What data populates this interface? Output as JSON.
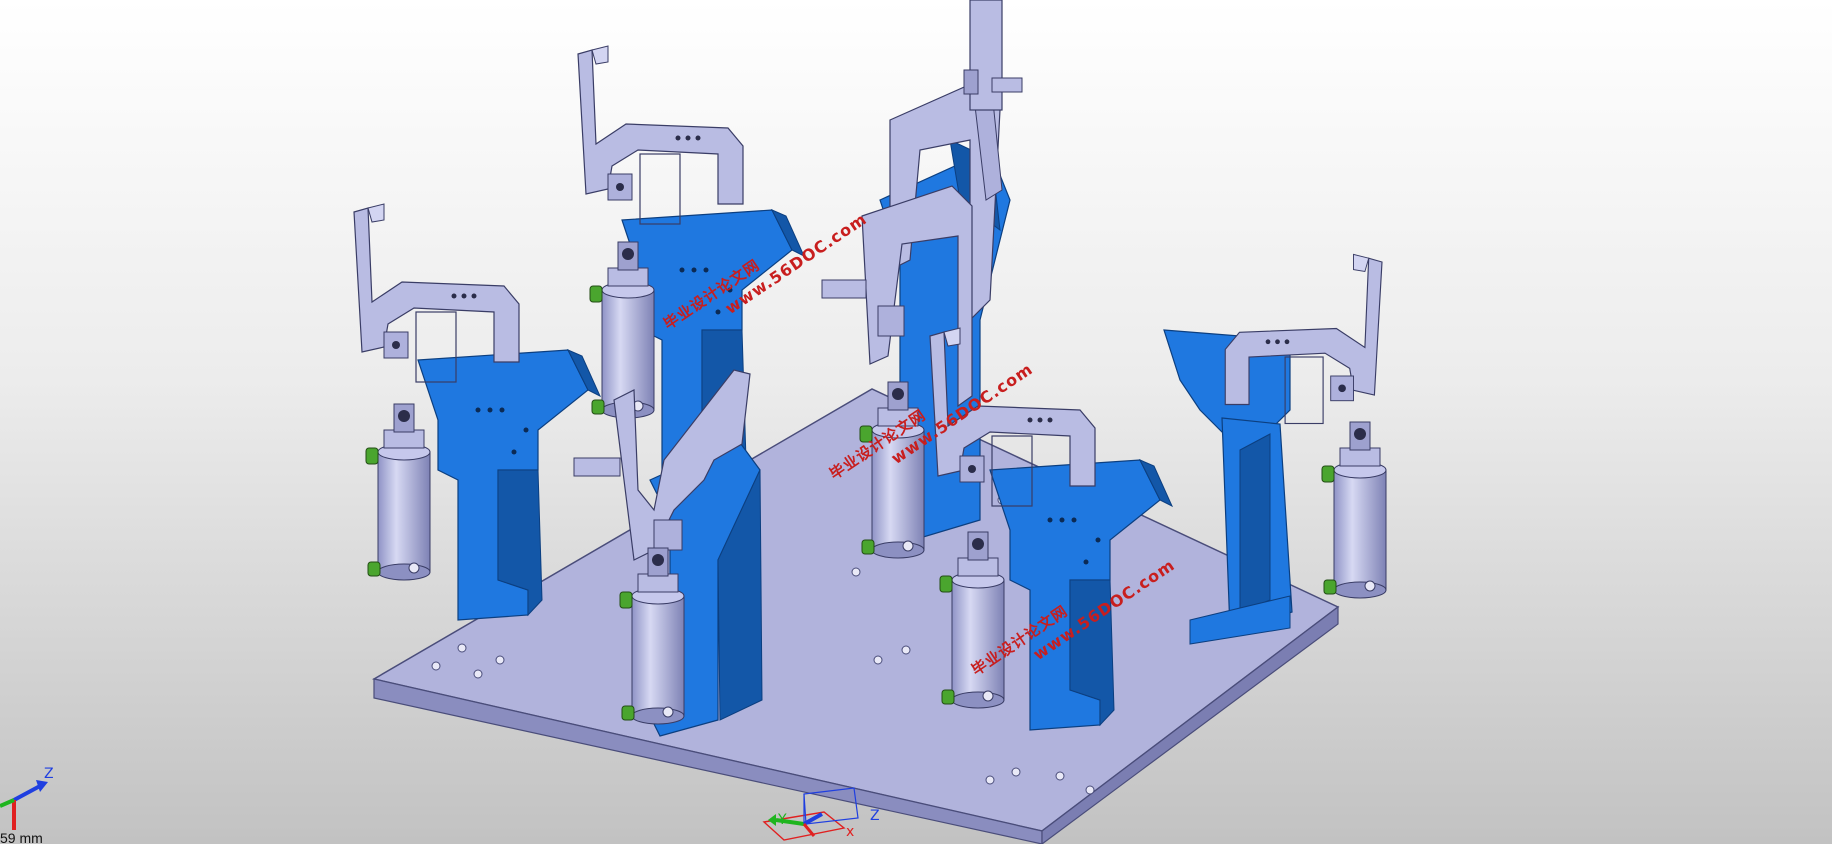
{
  "app": {
    "type": "CAD 3D viewport"
  },
  "colors": {
    "background_top": "#ffffff",
    "background_bottom": "#c2c2c2",
    "base_plate": "#a9abd6",
    "fixture_blue": "#1f78e0",
    "clamp_lavender": "#b9bce3",
    "fitting_green": "#4aa52e",
    "watermark_red": "#c81e1e",
    "axis_x": "#e02020",
    "axis_y": "#1fb51f",
    "axis_z": "#1f3fe0"
  },
  "watermarks": [
    {
      "line1": "毕业设计论文网",
      "line2": "www.56DOC.com"
    },
    {
      "line1": "毕业设计论文网",
      "line2": "www.56DOC.com"
    },
    {
      "line1": "毕业设计论文网",
      "line2": "www.56DOC.com"
    }
  ],
  "compass": {
    "x_label": "x",
    "y_label": "Y",
    "z_label": "Z"
  },
  "triad": {
    "z_label": "Z",
    "scale_readout": "59 mm"
  },
  "icons": [
    "compass-icon",
    "axis-triad-icon"
  ]
}
